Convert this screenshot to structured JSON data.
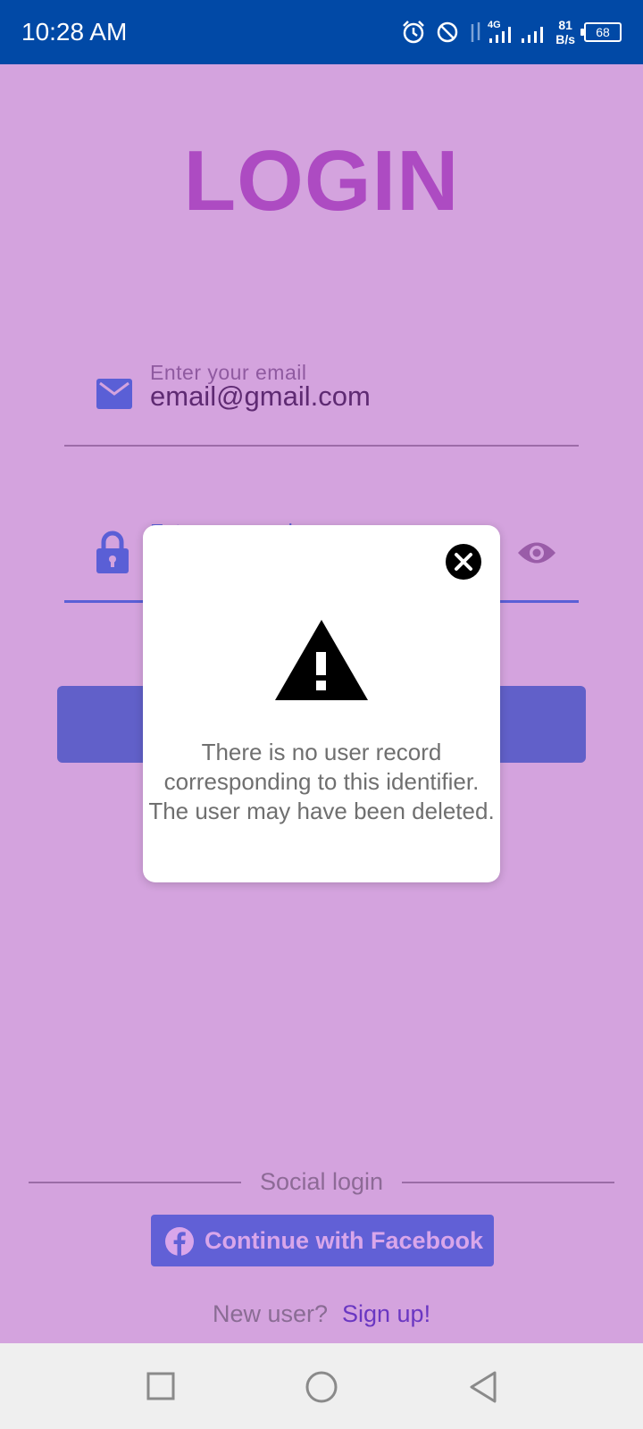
{
  "status_bar": {
    "time": "10:28 AM",
    "network": "4G",
    "speed_value": "81",
    "speed_unit": "B/s",
    "battery": "68"
  },
  "login": {
    "title": "LOGIN",
    "email_label": "Enter your email",
    "email_value": "email@gmail.com",
    "password_label": "Enter password"
  },
  "dialog": {
    "message": "There is no user record corresponding to this identifier. The user may have been deleted."
  },
  "social": {
    "label": "Social login",
    "facebook_button": "Continue with Facebook",
    "new_user_text": "New user?",
    "sign_up_link": "Sign up!"
  },
  "colors": {
    "background": "#d4a3de",
    "status_bar": "#0149a6",
    "title": "#ad4bc2",
    "accent": "#6160c9",
    "dialog": "#ffffff"
  },
  "icons": {
    "email": "email-icon",
    "lock": "lock-icon",
    "visibility": "eye-icon",
    "close": "close-icon",
    "warning": "warning-icon",
    "facebook": "facebook-icon"
  }
}
